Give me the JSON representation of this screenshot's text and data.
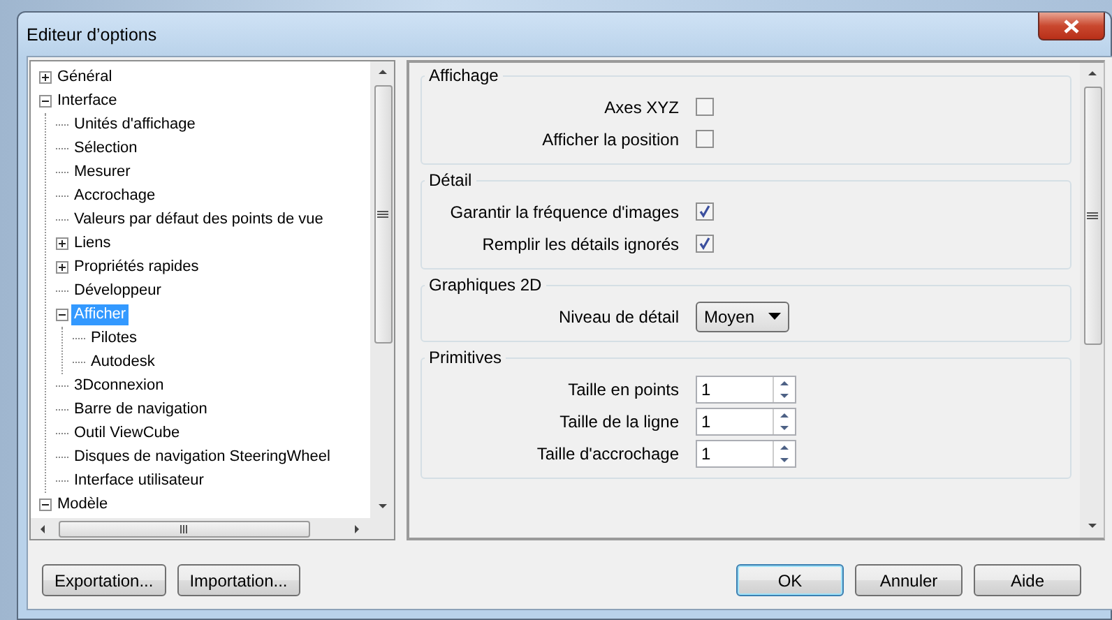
{
  "window": {
    "title": "Editeur d’options"
  },
  "tree": {
    "items": [
      {
        "label": "Général",
        "expanded": false,
        "selected": false
      },
      {
        "label": "Interface",
        "expanded": true,
        "selected": false,
        "children": [
          {
            "label": "Unités d'affichage",
            "selected": false
          },
          {
            "label": "Sélection",
            "selected": false
          },
          {
            "label": "Mesurer",
            "selected": false
          },
          {
            "label": "Accrochage",
            "selected": false
          },
          {
            "label": "Valeurs par défaut des points de vue",
            "selected": false
          },
          {
            "label": "Liens",
            "expanded": false,
            "selected": false
          },
          {
            "label": "Propriétés rapides",
            "expanded": false,
            "selected": false
          },
          {
            "label": "Développeur",
            "selected": false
          },
          {
            "label": "Afficher",
            "expanded": true,
            "selected": true,
            "children": [
              {
                "label": "Pilotes",
                "selected": false
              },
              {
                "label": "Autodesk",
                "selected": false
              }
            ]
          },
          {
            "label": "3Dconnexion",
            "selected": false
          },
          {
            "label": "Barre de navigation",
            "selected": false
          },
          {
            "label": "Outil ViewCube",
            "selected": false
          },
          {
            "label": "Disques de navigation SteeringWheel",
            "selected": false
          },
          {
            "label": "Interface utilisateur",
            "selected": false
          }
        ]
      },
      {
        "label": "Modèle",
        "expanded": true,
        "selected": false
      }
    ]
  },
  "groups": [
    {
      "title": "Affichage",
      "rows": [
        {
          "kind": "checkbox",
          "label": "Axes XYZ",
          "checked": false
        },
        {
          "kind": "checkbox",
          "label": "Afficher la position",
          "checked": false
        }
      ]
    },
    {
      "title": "Détail",
      "rows": [
        {
          "kind": "checkbox",
          "label": "Garantir la fréquence d'images",
          "checked": true
        },
        {
          "kind": "checkbox",
          "label": "Remplir les détails ignorés",
          "checked": true
        }
      ]
    },
    {
      "title": "Graphiques 2D",
      "rows": [
        {
          "kind": "dropdown",
          "label": "Niveau de détail",
          "value": "Moyen"
        }
      ]
    },
    {
      "title": "Primitives",
      "rows": [
        {
          "kind": "spinner",
          "label": "Taille en points",
          "value": "1"
        },
        {
          "kind": "spinner",
          "label": "Taille de la ligne",
          "value": "1"
        },
        {
          "kind": "spinner",
          "label": "Taille d'accrochage",
          "value": "1"
        }
      ]
    }
  ],
  "left_buttons": [
    {
      "label": "Exportation...",
      "default": false
    },
    {
      "label": "Importation...",
      "default": false
    }
  ],
  "right_buttons": [
    {
      "label": "OK",
      "default": true
    },
    {
      "label": "Annuler",
      "default": false
    },
    {
      "label": "Aide",
      "default": false
    }
  ]
}
